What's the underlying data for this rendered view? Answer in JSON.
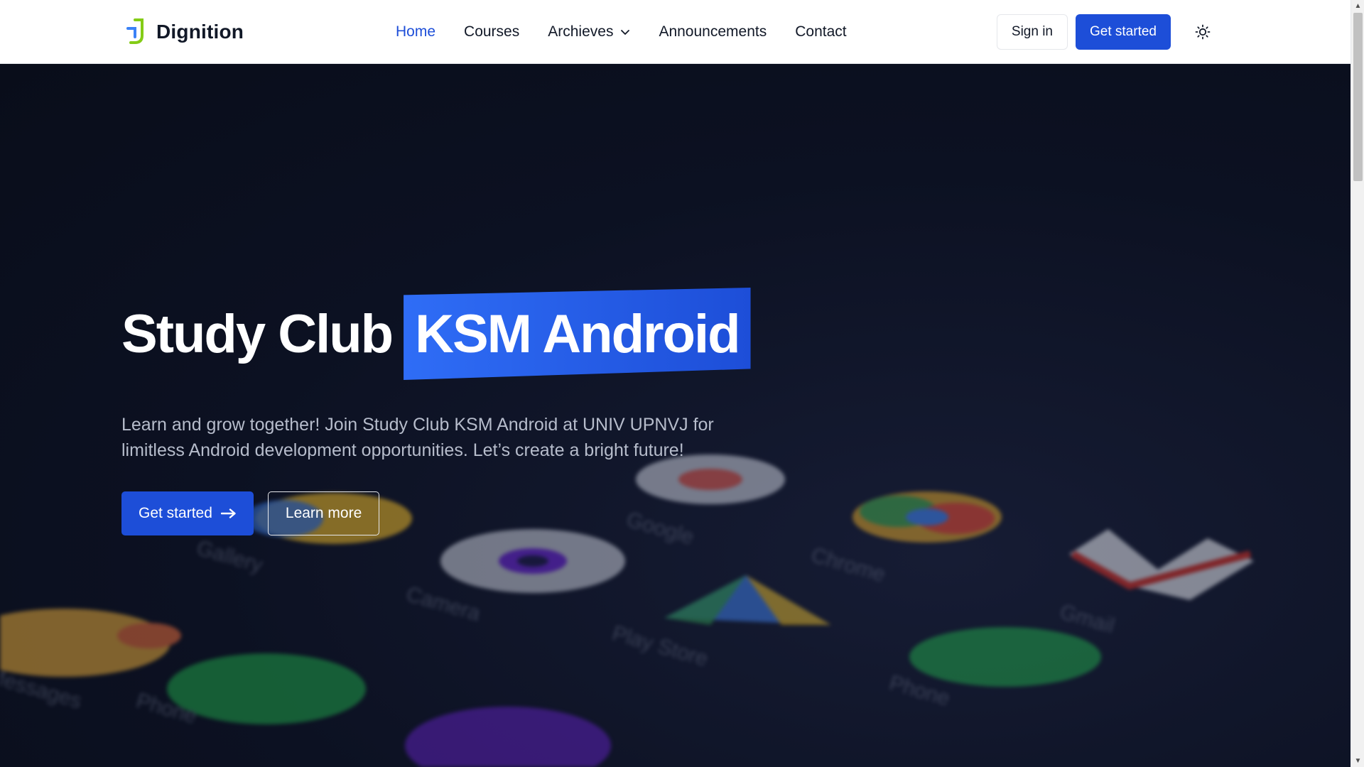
{
  "brand": {
    "name": "Dignition",
    "logo_icon": "dignition-logo-icon"
  },
  "nav": {
    "items": [
      {
        "label": "Home",
        "active": true
      },
      {
        "label": "Courses",
        "active": false
      },
      {
        "label": "Archieves",
        "active": false,
        "dropdown": true
      },
      {
        "label": "Announcements",
        "active": false
      },
      {
        "label": "Contact",
        "active": false
      }
    ]
  },
  "actions": {
    "sign_in": "Sign in",
    "get_started": "Get started",
    "theme_icon": "sun-icon"
  },
  "hero": {
    "title_plain": "Study Club",
    "title_highlight": "KSM Android",
    "description": "Learn and grow together! Join Study Club KSM Android at UNIV UPNVJ for limitless Android development opportunities. Let’s create a bright future!",
    "cta_primary": "Get started",
    "cta_secondary": "Learn more",
    "background_app_labels": [
      "Gallery",
      "Camera",
      "Play Store",
      "Chrome",
      "Gmail",
      "Phone",
      "Google",
      "Phone",
      "Messages"
    ]
  },
  "colors": {
    "accent": "#1d4ed8",
    "hero_bg": "#0c1122",
    "header_bg": "#ffffff"
  }
}
